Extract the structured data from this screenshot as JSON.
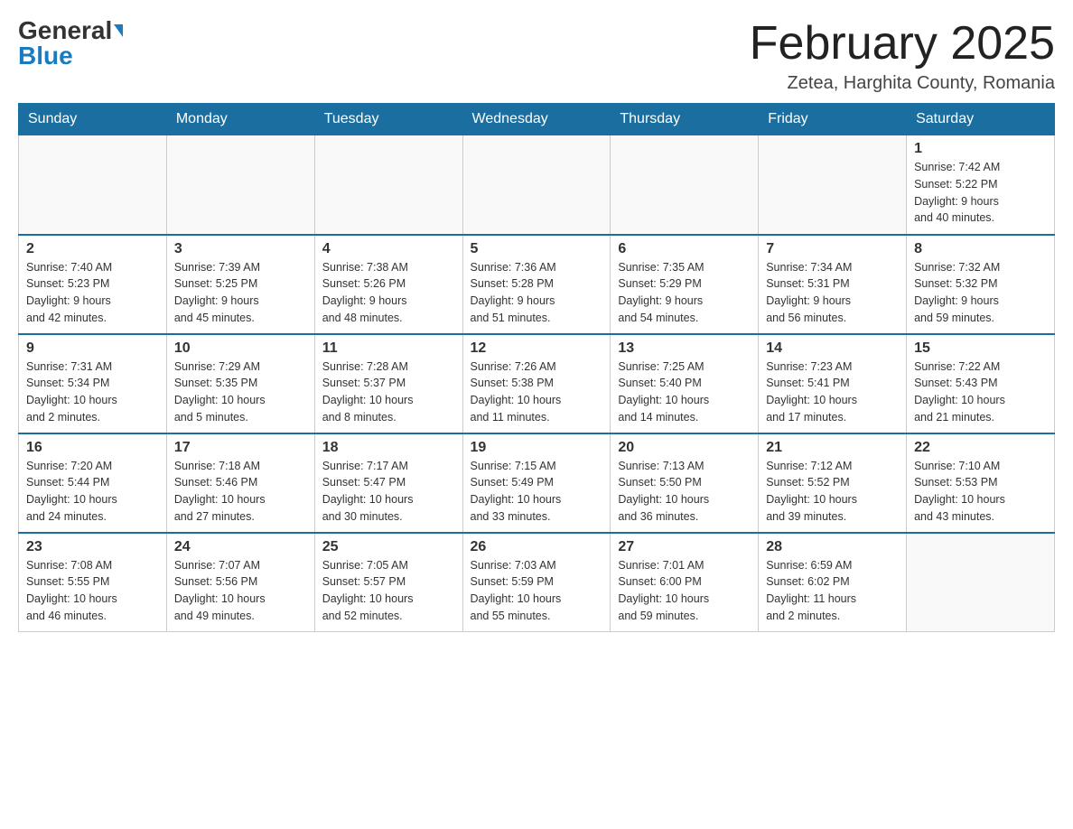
{
  "header": {
    "logo_general": "General",
    "logo_blue": "Blue",
    "month_title": "February 2025",
    "subtitle": "Zetea, Harghita County, Romania"
  },
  "days_of_week": [
    "Sunday",
    "Monday",
    "Tuesday",
    "Wednesday",
    "Thursday",
    "Friday",
    "Saturday"
  ],
  "weeks": [
    {
      "days": [
        {
          "number": "",
          "info": ""
        },
        {
          "number": "",
          "info": ""
        },
        {
          "number": "",
          "info": ""
        },
        {
          "number": "",
          "info": ""
        },
        {
          "number": "",
          "info": ""
        },
        {
          "number": "",
          "info": ""
        },
        {
          "number": "1",
          "info": "Sunrise: 7:42 AM\nSunset: 5:22 PM\nDaylight: 9 hours\nand 40 minutes."
        }
      ]
    },
    {
      "days": [
        {
          "number": "2",
          "info": "Sunrise: 7:40 AM\nSunset: 5:23 PM\nDaylight: 9 hours\nand 42 minutes."
        },
        {
          "number": "3",
          "info": "Sunrise: 7:39 AM\nSunset: 5:25 PM\nDaylight: 9 hours\nand 45 minutes."
        },
        {
          "number": "4",
          "info": "Sunrise: 7:38 AM\nSunset: 5:26 PM\nDaylight: 9 hours\nand 48 minutes."
        },
        {
          "number": "5",
          "info": "Sunrise: 7:36 AM\nSunset: 5:28 PM\nDaylight: 9 hours\nand 51 minutes."
        },
        {
          "number": "6",
          "info": "Sunrise: 7:35 AM\nSunset: 5:29 PM\nDaylight: 9 hours\nand 54 minutes."
        },
        {
          "number": "7",
          "info": "Sunrise: 7:34 AM\nSunset: 5:31 PM\nDaylight: 9 hours\nand 56 minutes."
        },
        {
          "number": "8",
          "info": "Sunrise: 7:32 AM\nSunset: 5:32 PM\nDaylight: 9 hours\nand 59 minutes."
        }
      ]
    },
    {
      "days": [
        {
          "number": "9",
          "info": "Sunrise: 7:31 AM\nSunset: 5:34 PM\nDaylight: 10 hours\nand 2 minutes."
        },
        {
          "number": "10",
          "info": "Sunrise: 7:29 AM\nSunset: 5:35 PM\nDaylight: 10 hours\nand 5 minutes."
        },
        {
          "number": "11",
          "info": "Sunrise: 7:28 AM\nSunset: 5:37 PM\nDaylight: 10 hours\nand 8 minutes."
        },
        {
          "number": "12",
          "info": "Sunrise: 7:26 AM\nSunset: 5:38 PM\nDaylight: 10 hours\nand 11 minutes."
        },
        {
          "number": "13",
          "info": "Sunrise: 7:25 AM\nSunset: 5:40 PM\nDaylight: 10 hours\nand 14 minutes."
        },
        {
          "number": "14",
          "info": "Sunrise: 7:23 AM\nSunset: 5:41 PM\nDaylight: 10 hours\nand 17 minutes."
        },
        {
          "number": "15",
          "info": "Sunrise: 7:22 AM\nSunset: 5:43 PM\nDaylight: 10 hours\nand 21 minutes."
        }
      ]
    },
    {
      "days": [
        {
          "number": "16",
          "info": "Sunrise: 7:20 AM\nSunset: 5:44 PM\nDaylight: 10 hours\nand 24 minutes."
        },
        {
          "number": "17",
          "info": "Sunrise: 7:18 AM\nSunset: 5:46 PM\nDaylight: 10 hours\nand 27 minutes."
        },
        {
          "number": "18",
          "info": "Sunrise: 7:17 AM\nSunset: 5:47 PM\nDaylight: 10 hours\nand 30 minutes."
        },
        {
          "number": "19",
          "info": "Sunrise: 7:15 AM\nSunset: 5:49 PM\nDaylight: 10 hours\nand 33 minutes."
        },
        {
          "number": "20",
          "info": "Sunrise: 7:13 AM\nSunset: 5:50 PM\nDaylight: 10 hours\nand 36 minutes."
        },
        {
          "number": "21",
          "info": "Sunrise: 7:12 AM\nSunset: 5:52 PM\nDaylight: 10 hours\nand 39 minutes."
        },
        {
          "number": "22",
          "info": "Sunrise: 7:10 AM\nSunset: 5:53 PM\nDaylight: 10 hours\nand 43 minutes."
        }
      ]
    },
    {
      "days": [
        {
          "number": "23",
          "info": "Sunrise: 7:08 AM\nSunset: 5:55 PM\nDaylight: 10 hours\nand 46 minutes."
        },
        {
          "number": "24",
          "info": "Sunrise: 7:07 AM\nSunset: 5:56 PM\nDaylight: 10 hours\nand 49 minutes."
        },
        {
          "number": "25",
          "info": "Sunrise: 7:05 AM\nSunset: 5:57 PM\nDaylight: 10 hours\nand 52 minutes."
        },
        {
          "number": "26",
          "info": "Sunrise: 7:03 AM\nSunset: 5:59 PM\nDaylight: 10 hours\nand 55 minutes."
        },
        {
          "number": "27",
          "info": "Sunrise: 7:01 AM\nSunset: 6:00 PM\nDaylight: 10 hours\nand 59 minutes."
        },
        {
          "number": "28",
          "info": "Sunrise: 6:59 AM\nSunset: 6:02 PM\nDaylight: 11 hours\nand 2 minutes."
        },
        {
          "number": "",
          "info": ""
        }
      ]
    }
  ]
}
